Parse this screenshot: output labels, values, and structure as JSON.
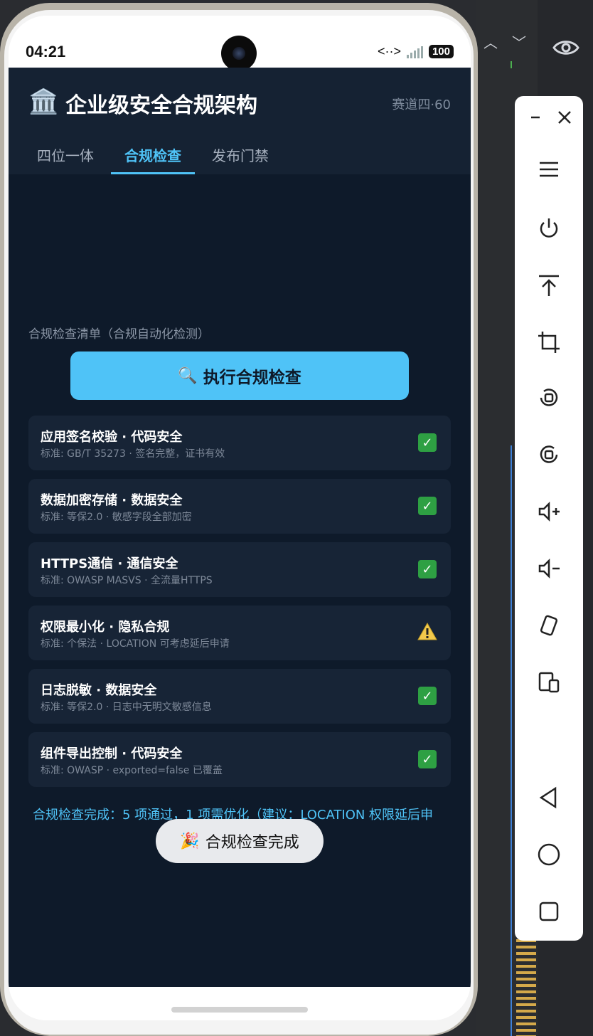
{
  "status_bar": {
    "time": "04:21",
    "battery": "100"
  },
  "app": {
    "title": "企业级安全合规架构",
    "subtitle": "赛道四·60",
    "tabs": [
      {
        "label": "四位一体",
        "active": false
      },
      {
        "label": "合规检查",
        "active": true
      },
      {
        "label": "发布门禁",
        "active": false
      }
    ],
    "section_label": "合规检查清单（合规自动化检测）",
    "run_button": {
      "icon": "🔍",
      "label": "执行合规检查"
    },
    "checks": [
      {
        "title": "应用签名校验 · 代码安全",
        "desc": "标准: GB/T 35273 · 签名完整，证书有效",
        "status": "pass"
      },
      {
        "title": "数据加密存储 · 数据安全",
        "desc": "标准: 等保2.0 · 敏感字段全部加密",
        "status": "pass"
      },
      {
        "title": "HTTPS通信 · 通信安全",
        "desc": "标准: OWASP MASVS · 全流量HTTPS",
        "status": "pass"
      },
      {
        "title": "权限最小化 · 隐私合规",
        "desc": "标准: 个保法 · LOCATION 可考虑延后申请",
        "status": "warn"
      },
      {
        "title": "日志脱敏 · 数据安全",
        "desc": "标准: 等保2.0 · 日志中无明文敏感信息",
        "status": "pass"
      },
      {
        "title": "组件导出控制 · 代码安全",
        "desc": "标准: OWASP · exported=false 已覆盖",
        "status": "pass"
      }
    ],
    "result_text": "合规检查完成：5 项通过，1 项需优化（建议：LOCATION 权限延后申",
    "toast": {
      "icon": "🎉",
      "label": "合规检查完成"
    }
  },
  "colors": {
    "accent": "#4fc3f7",
    "background": "#0e1a2a",
    "card": "#172436",
    "pass": "#2ea043",
    "warn": "#f2c94c"
  },
  "toolbar_icons": [
    "minimize-icon",
    "close-icon",
    "menu-icon",
    "power-icon",
    "upload-icon",
    "crop-icon",
    "rotate-left-icon",
    "rotate-right-icon",
    "volume-up-icon",
    "volume-down-icon",
    "device-rotate-icon",
    "device-mirror-icon",
    "back-icon",
    "home-icon",
    "overview-icon"
  ]
}
